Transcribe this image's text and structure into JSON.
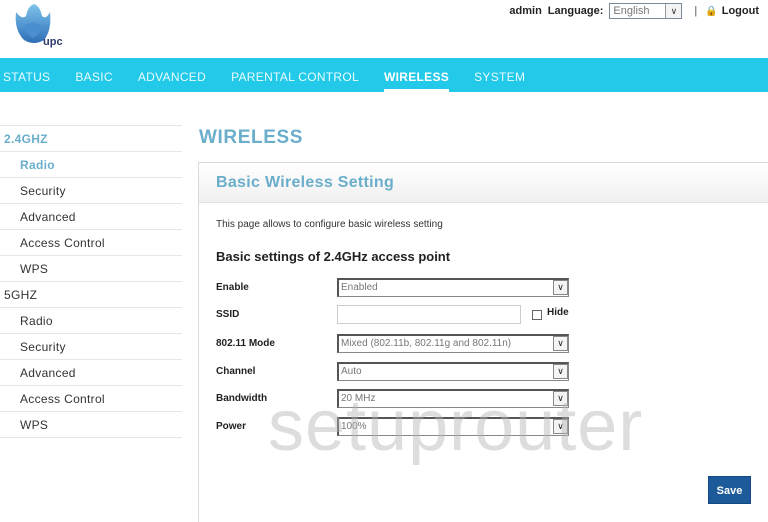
{
  "header": {
    "brand": "upc",
    "user": "admin",
    "language_label": "Language:",
    "language_value": "English",
    "logout_label": "Logout",
    "separator": "|"
  },
  "nav": {
    "items": [
      {
        "label": "STATUS"
      },
      {
        "label": "BASIC"
      },
      {
        "label": "ADVANCED"
      },
      {
        "label": "PARENTAL CONTROL"
      },
      {
        "label": "WIRELESS"
      },
      {
        "label": "SYSTEM"
      }
    ],
    "active": "WIRELESS"
  },
  "sidebar": {
    "groups": [
      {
        "label": "2.4GHZ",
        "items": [
          "Radio",
          "Security",
          "Advanced",
          "Access Control",
          "WPS"
        ]
      },
      {
        "label": "5GHZ",
        "items": [
          "Radio",
          "Security",
          "Advanced",
          "Access Control",
          "WPS"
        ]
      }
    ],
    "active": "2.4GHZ / Radio"
  },
  "page": {
    "title": "WIRELESS",
    "panel_title": "Basic Wireless Setting",
    "description": "This page allows to configure basic wireless setting",
    "section_title": "Basic settings of 2.4GHz access point",
    "fields": {
      "enable": {
        "label": "Enable",
        "value": "Enabled"
      },
      "ssid": {
        "label": "SSID",
        "value": "",
        "hide_label": "Hide",
        "hide_checked": false
      },
      "mode": {
        "label": "802.11 Mode",
        "value": "Mixed (802.11b, 802.11g and 802.11n)"
      },
      "channel": {
        "label": "Channel",
        "value": "Auto"
      },
      "bandwidth": {
        "label": "Bandwidth",
        "value": "20 MHz"
      },
      "power": {
        "label": "Power",
        "value": "100%"
      }
    },
    "save_label": "Save"
  },
  "watermark": "setuprouter",
  "colors": {
    "accent": "#22c9e9",
    "title": "#6aaecb",
    "button": "#1d5a99"
  }
}
